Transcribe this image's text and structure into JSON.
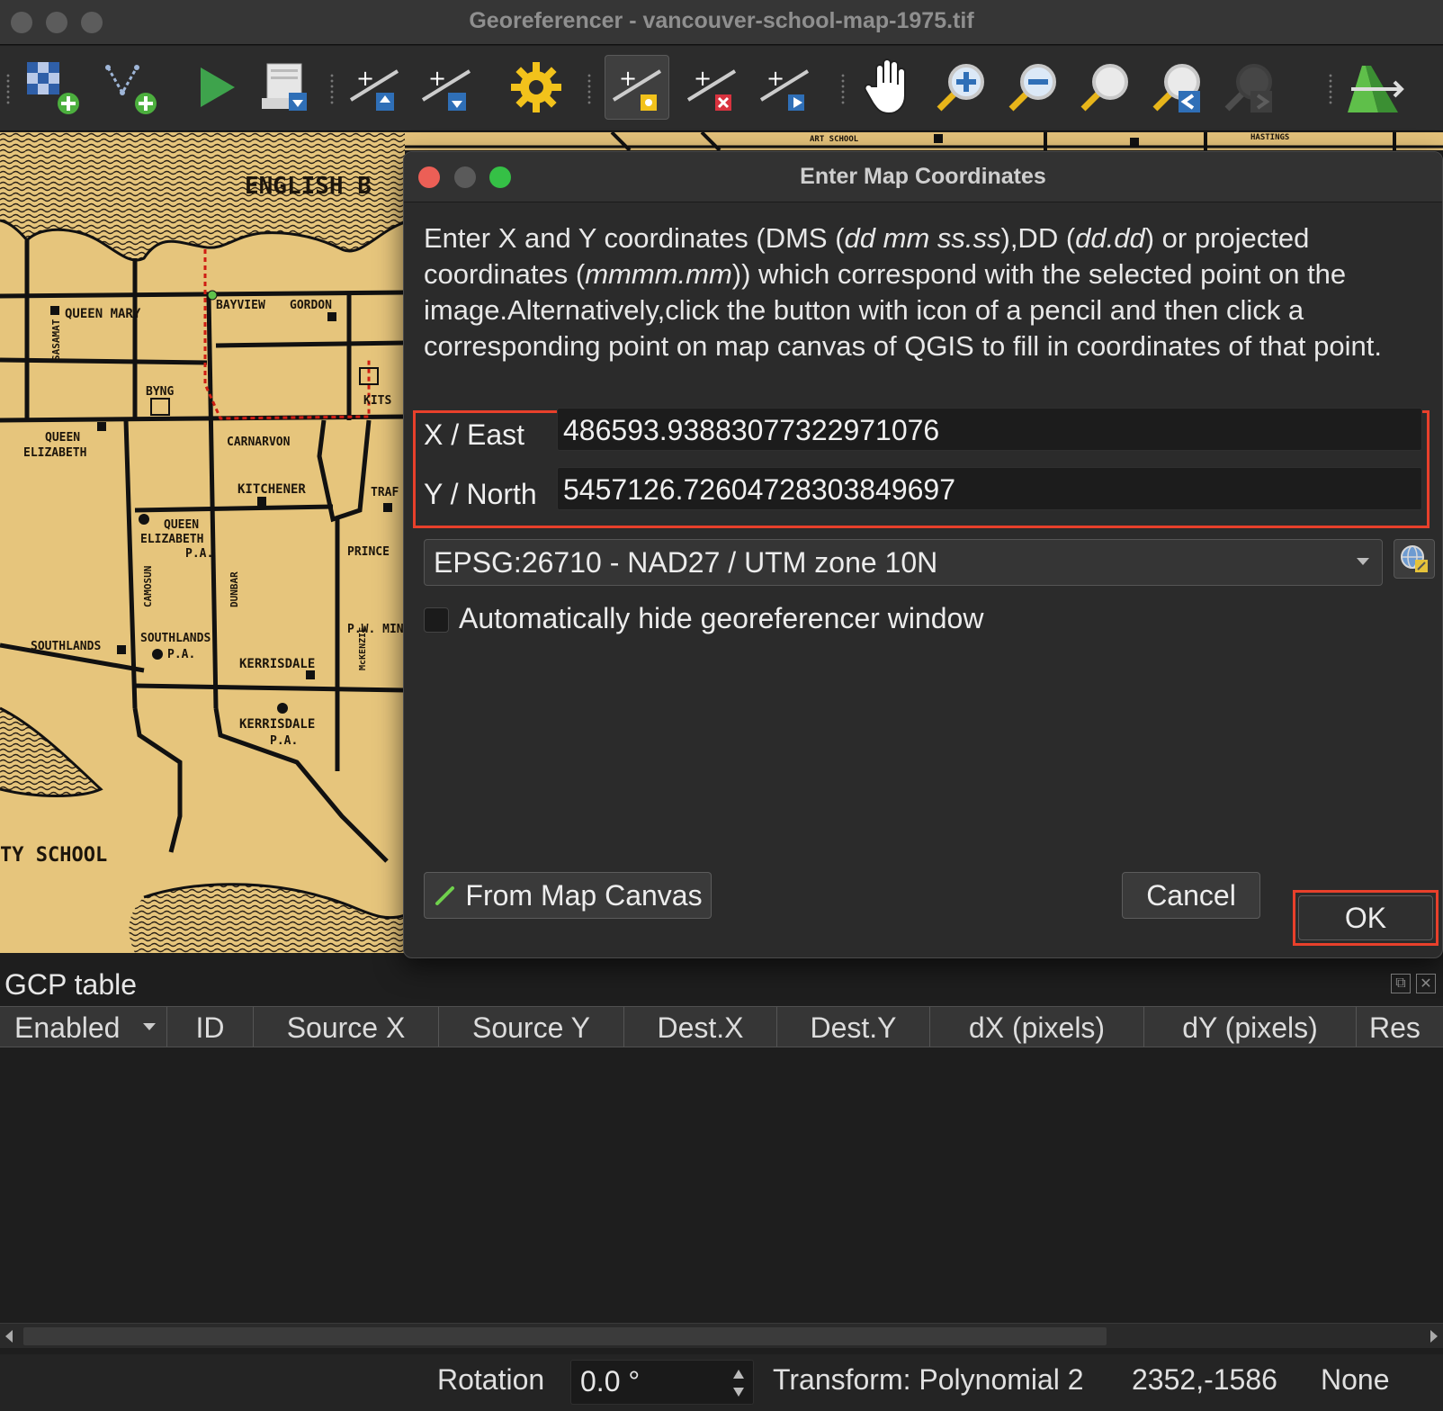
{
  "window": {
    "title": "Georeferencer - vancouver-school-map-1975.tif"
  },
  "toolbar": {
    "icons": [
      "open-raster-icon",
      "start-georeferencing-icon",
      "generate-gdal-script-icon",
      "load-gcp-points-icon",
      "save-gcp-points-icon",
      "transformation-settings-icon",
      "add-point-icon",
      "delete-point-icon",
      "move-gcp-point-icon",
      "pan-icon",
      "zoom-in-icon",
      "zoom-out-icon",
      "zoom-to-layer-icon",
      "zoom-last-icon",
      "zoom-next-icon",
      "link-georeferencer-to-qgis-icon"
    ]
  },
  "map": {
    "labels": [
      "ENGLISH B",
      "QUEEN MARY",
      "BAYVIEW",
      "GORDON",
      "SASAMAT",
      "BYNG",
      "KITS",
      "QUEEN",
      "ELIZABETH",
      "CARNARVON",
      "KITCHENER",
      "TRAF",
      "QUEEN",
      "ELIZABETH",
      "P.A.",
      "CAMOSUN",
      "DUNBAR",
      "PRINCE",
      "SOUTHLANDS",
      "SOUTHLANDS",
      "P.A.",
      "McKENZIE",
      "P.W. MINI",
      "KERRISDALE",
      "KERRISDALE",
      "P.A.",
      "TY SCHOOL",
      "HASTINGS",
      "ART SCHOOL"
    ]
  },
  "dialog": {
    "title": "Enter Map Coordinates",
    "instructions": {
      "p1": "Enter X and Y coordinates (DMS (",
      "i1": "dd mm ss.ss",
      "p2": "),DD (",
      "i2": "dd.dd",
      "p3": ") or projected coordinates (",
      "i3": "mmmm.mm",
      "p4": ")) which correspond with the selected point on the image.Alternatively,click the button with icon of a pencil and then click a corresponding point on map canvas of QGIS to fill in coordinates of that point."
    },
    "x_label": "X / East",
    "x_value": "486593.93883077322971076",
    "y_label": "Y / North",
    "y_value": "5457126.72604728303849697",
    "crs": "EPSG:26710 - NAD27 / UTM zone 10N",
    "auto_hide_label": "Automatically hide georeferencer window",
    "auto_hide_checked": false,
    "from_canvas_label": "From Map Canvas",
    "cancel_label": "Cancel",
    "ok_label": "OK",
    "highlight_color": "#e8402b"
  },
  "gcp": {
    "title": "GCP table",
    "columns": [
      "Enabled",
      "ID",
      "Source X",
      "Source Y",
      "Dest.X",
      "Dest.Y",
      "dX (pixels)",
      "dY (pixels)",
      "Res"
    ],
    "rows": []
  },
  "status": {
    "rotation_label": "Rotation",
    "rotation_value": "0.0 °",
    "transform": "Transform: Polynomial 2",
    "coords": "2352,-1586",
    "crs": "None"
  }
}
